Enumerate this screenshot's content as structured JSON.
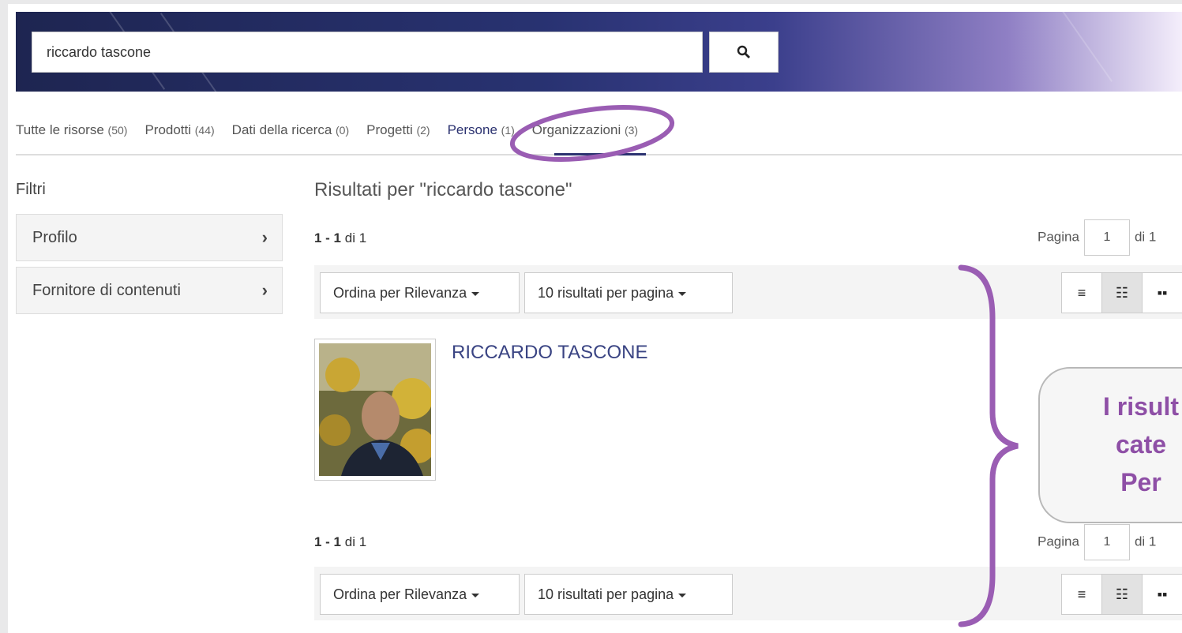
{
  "search": {
    "value": "riccardo tascone"
  },
  "tabs": [
    {
      "label": "Tutte le risorse",
      "count": "(50)"
    },
    {
      "label": "Prodotti",
      "count": "(44)"
    },
    {
      "label": "Dati della ricerca",
      "count": "(0)"
    },
    {
      "label": "Progetti",
      "count": "(2)"
    },
    {
      "label": "Persone",
      "count": "(1)"
    },
    {
      "label": "Organizzazioni",
      "count": "(3)"
    }
  ],
  "sidebar": {
    "title": "Filtri",
    "facets": [
      {
        "label": "Profilo"
      },
      {
        "label": "Fornitore di contenuti"
      }
    ]
  },
  "results": {
    "title": "Risultati per \"riccardo tascone\"",
    "range": "1 - 1",
    "of": "di 1",
    "page_label": "Pagina",
    "page_value": "1",
    "page_total": "di 1",
    "sort_label": "Ordina per Rilevanza",
    "per_page_label": "10 risultati per pagina",
    "items": [
      {
        "name": "RICCARDO TASCONE"
      }
    ]
  },
  "annotation": {
    "line1": "I risult",
    "line2": "cate",
    "line3": "Per",
    "color": "#8e4fa6"
  }
}
